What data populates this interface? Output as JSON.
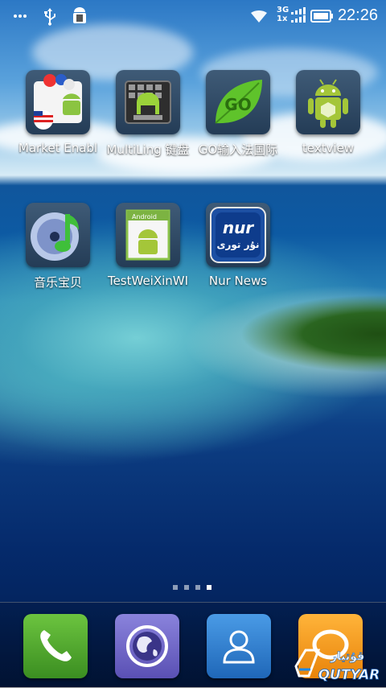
{
  "status_bar": {
    "time": "22:26",
    "network_top": "3G",
    "network_bottom": "1x",
    "left_icons": [
      "overflow-dots-icon",
      "usb-icon",
      "debug-android-icon"
    ],
    "right_icons": [
      "wifi-icon",
      "signal-icon",
      "battery-icon"
    ]
  },
  "apps": [
    {
      "label": "Market Enabl",
      "icon": "market-enabler-icon"
    },
    {
      "label": "MultiLing 键盘",
      "icon": "keyboard-icon"
    },
    {
      "label": "GO输入法国际",
      "icon": "go-keyboard-icon"
    },
    {
      "label": "textview",
      "icon": "android-robot-icon"
    },
    {
      "label": "音乐宝贝",
      "icon": "music-cd-icon"
    },
    {
      "label": "TestWeiXinWI",
      "icon": "android-apk-icon"
    },
    {
      "label": "Nur News",
      "icon": "nur-news-icon"
    }
  ],
  "nur_logo": {
    "latin": "nur",
    "uyghur": "نۇر تورى"
  },
  "go_logo": "GO",
  "android_label": "Android",
  "page_indicator": {
    "pages": 4,
    "current": 4
  },
  "dock": [
    {
      "icon": "phone-icon",
      "color": "#4aa52e"
    },
    {
      "icon": "browser-globe-icon",
      "color": "#6c63c4"
    },
    {
      "icon": "contacts-icon",
      "color": "#2f7fd0"
    },
    {
      "icon": "messages-icon",
      "color": "#f29a12"
    }
  ],
  "watermark": {
    "text": "QUTYAR",
    "script": "قۇتيار"
  }
}
